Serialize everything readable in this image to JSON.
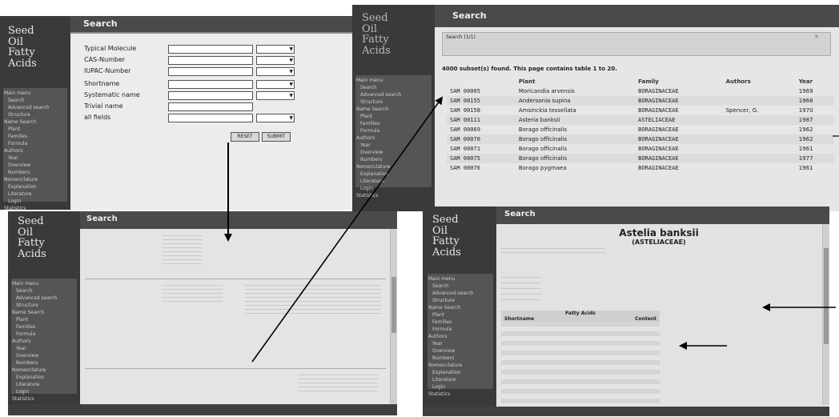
{
  "logo": {
    "lines": [
      "Seed",
      "Oil",
      "Fatty",
      "Acids"
    ]
  },
  "header_title": "Search",
  "search_form": {
    "fields": [
      {
        "label": "Typical Molecule",
        "value": "",
        "operator": ""
      },
      {
        "label": "CAS-Number",
        "value": "",
        "operator": ""
      },
      {
        "label": "IUPAC-Number",
        "value": "",
        "operator": ""
      },
      {
        "label": "Shortname",
        "value": "",
        "operator": ""
      },
      {
        "label": "Systematic name",
        "value": "",
        "operator": ""
      },
      {
        "label": "Trivial name",
        "value": "",
        "operator": ""
      },
      {
        "label": "all fields",
        "value": "",
        "operator": ""
      }
    ],
    "buttons": {
      "reset": "RESET",
      "submit": "SUBMIT"
    },
    "nav": [
      "Main menu",
      "Search",
      "Advanced search",
      "Structure",
      "Name Search",
      "Plant",
      "Families",
      "Formula",
      "Authors",
      "Year",
      "Overview",
      "Numbers",
      "Nomenclature",
      "Explanation",
      "Literature",
      "Login",
      "Statistics"
    ]
  },
  "results": {
    "query_text": "Search (1/1)",
    "summary": "4000 subset(s) found. This page contains table 1 to 20.",
    "columns": [
      "Plant",
      "Family",
      "Authors",
      "Year"
    ],
    "rows": [
      {
        "id": "SAM 00005",
        "plant": "Moricandia arvensis",
        "family": "BORAGINACEAE",
        "authors": "",
        "year": "1969"
      },
      {
        "id": "SAM 00155",
        "plant": "Andersonia supina",
        "family": "BORAGINACEAE",
        "authors": "",
        "year": "1966"
      },
      {
        "id": "SAM 00158",
        "plant": "Amsinckia tessellata",
        "family": "BORAGINACEAE",
        "authors": "Spencer, G.",
        "year": "1970"
      },
      {
        "id": "SAM 00111",
        "plant": "Asteria banksii",
        "family": "ASTELIACEAE",
        "authors": "",
        "year": "1987"
      },
      {
        "id": "SAM 00069",
        "plant": "Borago officinalis",
        "family": "BORAGINACEAE",
        "authors": "",
        "year": "1962"
      },
      {
        "id": "SAM 00070",
        "plant": "Borago officinalis",
        "family": "BORAGINACEAE",
        "authors": "",
        "year": "1962"
      },
      {
        "id": "SAM 00071",
        "plant": "Borago officinalis",
        "family": "BORAGINACEAE",
        "authors": "",
        "year": "1961"
      },
      {
        "id": "SAM 00075",
        "plant": "Borago officinalis",
        "family": "BORAGINACEAE",
        "authors": "",
        "year": "1977"
      },
      {
        "id": "SAM 00076",
        "plant": "Borago pygmaea",
        "family": "BORAGINACEAE",
        "authors": "",
        "year": "1961"
      }
    ]
  },
  "detail": {
    "title": "Astelia banksii",
    "family": "(ASTELIACEAE)",
    "fatty_acids_header": "Fatty Acids",
    "fa_col1": "Shortname",
    "fa_col2": "Content"
  },
  "compound": {
    "records": [
      "",
      ""
    ]
  },
  "colors": {
    "sidebar": "#3a3a3a",
    "topbar": "#4a4a4a",
    "page": "#e6e6e6",
    "arrow": "#000000"
  }
}
